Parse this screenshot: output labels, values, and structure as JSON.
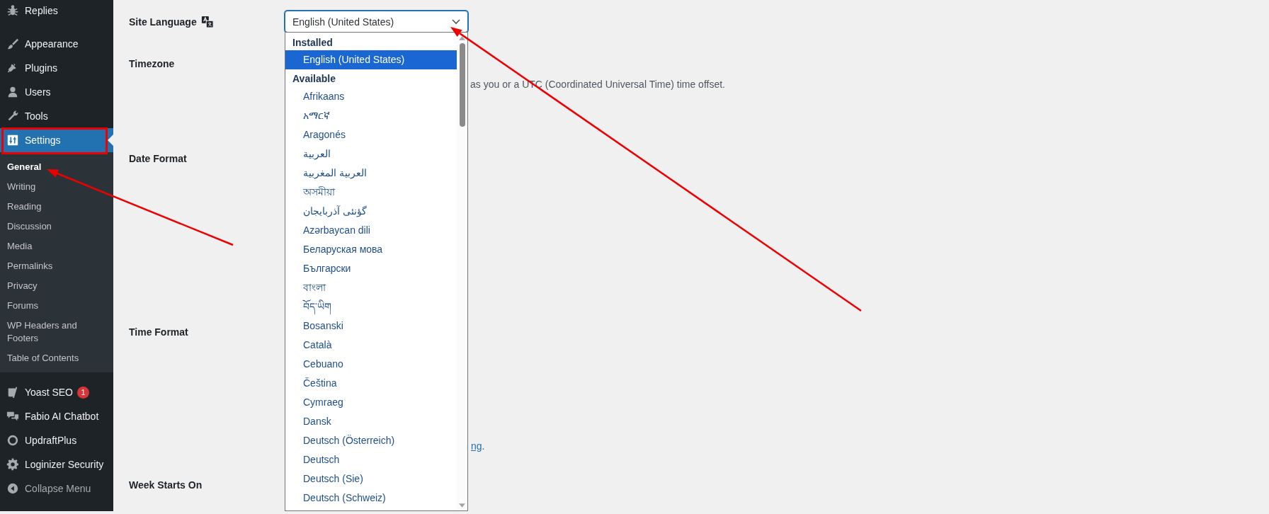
{
  "sidebar": {
    "items": [
      {
        "label": "Replies",
        "selected": false
      },
      {
        "label": "Appearance",
        "selected": false
      },
      {
        "label": "Plugins",
        "selected": false
      },
      {
        "label": "Users",
        "selected": false
      },
      {
        "label": "Tools",
        "selected": false
      },
      {
        "label": "Settings",
        "selected": true,
        "children": [
          {
            "label": "General",
            "selected": true
          },
          {
            "label": "Writing",
            "selected": false
          },
          {
            "label": "Reading",
            "selected": false
          },
          {
            "label": "Discussion",
            "selected": false
          },
          {
            "label": "Media",
            "selected": false
          },
          {
            "label": "Permalinks",
            "selected": false
          },
          {
            "label": "Privacy",
            "selected": false
          },
          {
            "label": "Forums",
            "selected": false
          },
          {
            "label": "WP Headers and Footers",
            "selected": false
          },
          {
            "label": "Table of Contents",
            "selected": false
          }
        ]
      },
      {
        "label": "Yoast SEO",
        "selected": false,
        "badge": "1"
      },
      {
        "label": "Fabio AI Chatbot",
        "selected": false
      },
      {
        "label": "UpdraftPlus",
        "selected": false
      },
      {
        "label": "Loginizer Security",
        "selected": false
      }
    ],
    "collapse": {
      "label": "Collapse Menu"
    }
  },
  "settings": {
    "rows": [
      {
        "label": "Site Language",
        "kind": "language"
      },
      {
        "label": "Timezone",
        "kind": "note",
        "text": "as you or a UTC (Coordinated Universal Time) time offset."
      },
      {
        "label": "Date Format",
        "kind": "plain"
      },
      {
        "label": "Time Format",
        "kind": "link_note",
        "link": "ng",
        "tail": "."
      },
      {
        "label": "Week Starts On",
        "kind": "plain"
      }
    ]
  },
  "language_select": {
    "value": "English (United States)",
    "expanded": true,
    "groups": [
      {
        "label": "Installed",
        "options": [
          {
            "label": "English (United States)",
            "selected": true
          }
        ]
      },
      {
        "label": "Available",
        "options": [
          {
            "label": "Afrikaans",
            "selected": false
          },
          {
            "label": "አማርኛ",
            "selected": false
          },
          {
            "label": "Aragonés",
            "selected": false
          },
          {
            "label": "العربية",
            "selected": false
          },
          {
            "label": "العربية المغربية",
            "selected": false
          },
          {
            "label": "অসমীয়া",
            "selected": false
          },
          {
            "label": "گؤنئی آذربایجان",
            "selected": false
          },
          {
            "label": "Azərbaycan dili",
            "selected": false
          },
          {
            "label": "Беларуская мова",
            "selected": false
          },
          {
            "label": "Български",
            "selected": false
          },
          {
            "label": "বাংলা",
            "selected": false
          },
          {
            "label": "བོད་ཡིག",
            "selected": false
          },
          {
            "label": "Bosanski",
            "selected": false
          },
          {
            "label": "Català",
            "selected": false
          },
          {
            "label": "Cebuano",
            "selected": false
          },
          {
            "label": "Čeština",
            "selected": false
          },
          {
            "label": "Cymraeg",
            "selected": false
          },
          {
            "label": "Dansk",
            "selected": false
          },
          {
            "label": "Deutsch (Österreich)",
            "selected": false
          },
          {
            "label": "Deutsch",
            "selected": false
          },
          {
            "label": "Deutsch (Sie)",
            "selected": false
          },
          {
            "label": "Deutsch (Schweiz)",
            "selected": false
          }
        ]
      }
    ]
  }
}
